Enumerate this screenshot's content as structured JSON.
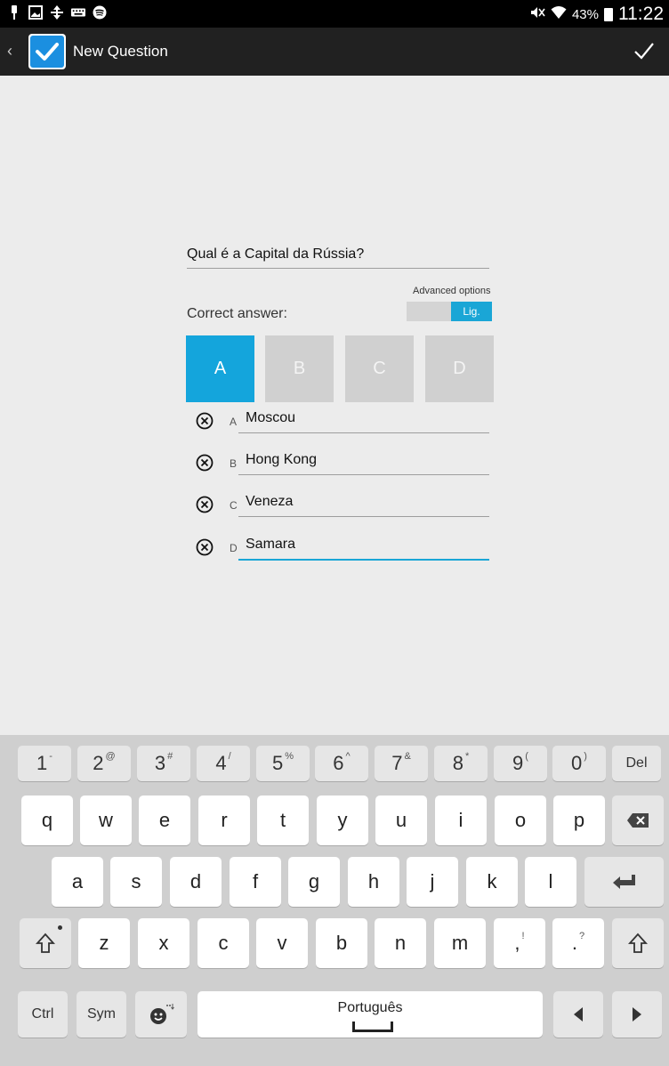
{
  "status_bar": {
    "left_icons": [
      "pin-icon",
      "gallery-icon",
      "transfer-icon",
      "keyboard-icon",
      "spotify-icon"
    ],
    "battery": "43%",
    "time": "11:22"
  },
  "action_bar": {
    "title": "New Question"
  },
  "form": {
    "question": "Qual é a Capital da Rússia?",
    "advanced_options_label": "Advanced options",
    "toggle_label": "Lig.",
    "correct_answer_label": "Correct answer:",
    "answer_buttons": [
      "A",
      "B",
      "C",
      "D"
    ],
    "selected_answer": "A",
    "answers": [
      {
        "letter": "A",
        "value": "Moscou"
      },
      {
        "letter": "B",
        "value": "Hong Kong"
      },
      {
        "letter": "C",
        "value": "Veneza"
      },
      {
        "letter": "D",
        "value": "Samara"
      }
    ]
  },
  "keyboard": {
    "number_row": [
      {
        "main": "1",
        "alt": "-"
      },
      {
        "main": "2",
        "alt": "@"
      },
      {
        "main": "3",
        "alt": "#"
      },
      {
        "main": "4",
        "alt": "/"
      },
      {
        "main": "5",
        "alt": "%"
      },
      {
        "main": "6",
        "alt": "^"
      },
      {
        "main": "7",
        "alt": "&"
      },
      {
        "main": "8",
        "alt": "*"
      },
      {
        "main": "9",
        "alt": "("
      },
      {
        "main": "0",
        "alt": ")"
      }
    ],
    "del_label": "Del",
    "row1": [
      "q",
      "w",
      "e",
      "r",
      "t",
      "y",
      "u",
      "i",
      "o",
      "p"
    ],
    "row2": [
      "a",
      "s",
      "d",
      "f",
      "g",
      "h",
      "j",
      "k",
      "l"
    ],
    "row3": [
      "z",
      "x",
      "c",
      "v",
      "b",
      "n",
      "m"
    ],
    "comma_key": {
      "main": ",",
      "alt": "!"
    },
    "period_key": {
      "main": ".",
      "alt": "?"
    },
    "ctrl_label": "Ctrl",
    "sym_label": "Sym",
    "space_label": "Português"
  }
}
